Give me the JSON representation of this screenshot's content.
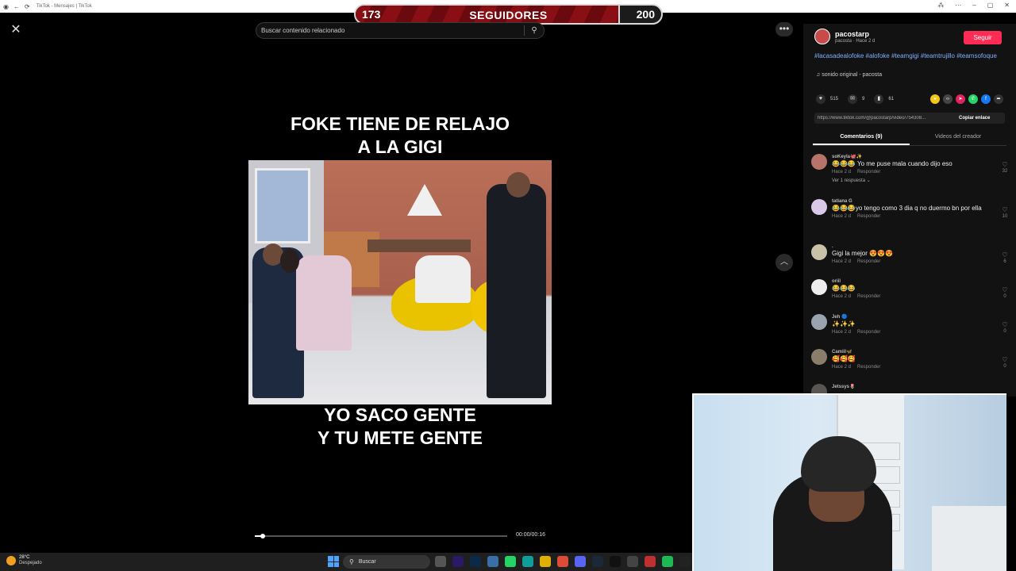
{
  "browser": {
    "tab_title": "TikTok - Mensajes | TikTok"
  },
  "followers_goal": {
    "current": "173",
    "label": "SEGUIDORES",
    "goal": "200",
    "progress": 0.865
  },
  "search": {
    "placeholder": "Buscar contenido relacionado"
  },
  "video": {
    "caption_top": [
      "FOKE TIENE DE RELAJO",
      "A LA GIGI"
    ],
    "caption_bottom": [
      "YO SACO GENTE",
      "Y TU METE GENTE"
    ],
    "time": "00:00/00:16",
    "progress": 0.03
  },
  "creator": {
    "username": "pacostarp",
    "subtitle": "pacosta · Hace 2 d",
    "follow_label": "Seguir",
    "hashtags": "#lacasadealofoke #alofoke #teamgigi #teamtrujillo #teamsofoque",
    "sound": "sonido original - pacosta"
  },
  "actions": {
    "likes": "515",
    "comments": "9",
    "saves": "61"
  },
  "link": {
    "url": "https://www.tiktok.com/@pacostarp/video/754308...",
    "copy_label": "Copiar enlace"
  },
  "tabs": {
    "comments": "Comentarios (9)",
    "creator_videos": "Videos del creador"
  },
  "comments": [
    {
      "user": "soKeyla🐙✨",
      "text": "😂😂😂 Yo me puse mala cuando dijo eso",
      "time": "Hace 2 d",
      "reply": "Responder",
      "likes": "32",
      "more": "Ver 1 respuesta ⌄"
    },
    {
      "user": "tatiana G",
      "text": "😂😂😂yo tengo como 3 dia q no duermo bn por ella",
      "time": "Hace 2 d",
      "reply": "Responder",
      "likes": "10"
    },
    {
      "user": ".",
      "text": "Gigi la mejor 😍😍😍",
      "time": "Hace 2 d",
      "reply": "Responder",
      "likes": "6"
    },
    {
      "user": "oriil",
      "text": "😂😂😂",
      "time": "Hace 2 d",
      "reply": "Responder",
      "likes": "0"
    },
    {
      "user": "Jeh 🔵",
      "text": "✨✨✨",
      "time": "Hace 2 d",
      "reply": "Responder",
      "likes": "0"
    },
    {
      "user": "Camiil🦋",
      "text": "🥰🥰🥰",
      "time": "Hace 2 d",
      "reply": "Responder",
      "likes": "0"
    },
    {
      "user": "Jetssys🌷",
      "text": "",
      "time": "",
      "reply": "",
      "likes": ""
    }
  ],
  "taskbar": {
    "temp": "28°C",
    "weather": "Despejado",
    "search_label": "Buscar"
  },
  "colors": {
    "follow": "#fe2c55",
    "hashtag": "#7fb0ff",
    "progress_fill": "#8a0f14"
  }
}
